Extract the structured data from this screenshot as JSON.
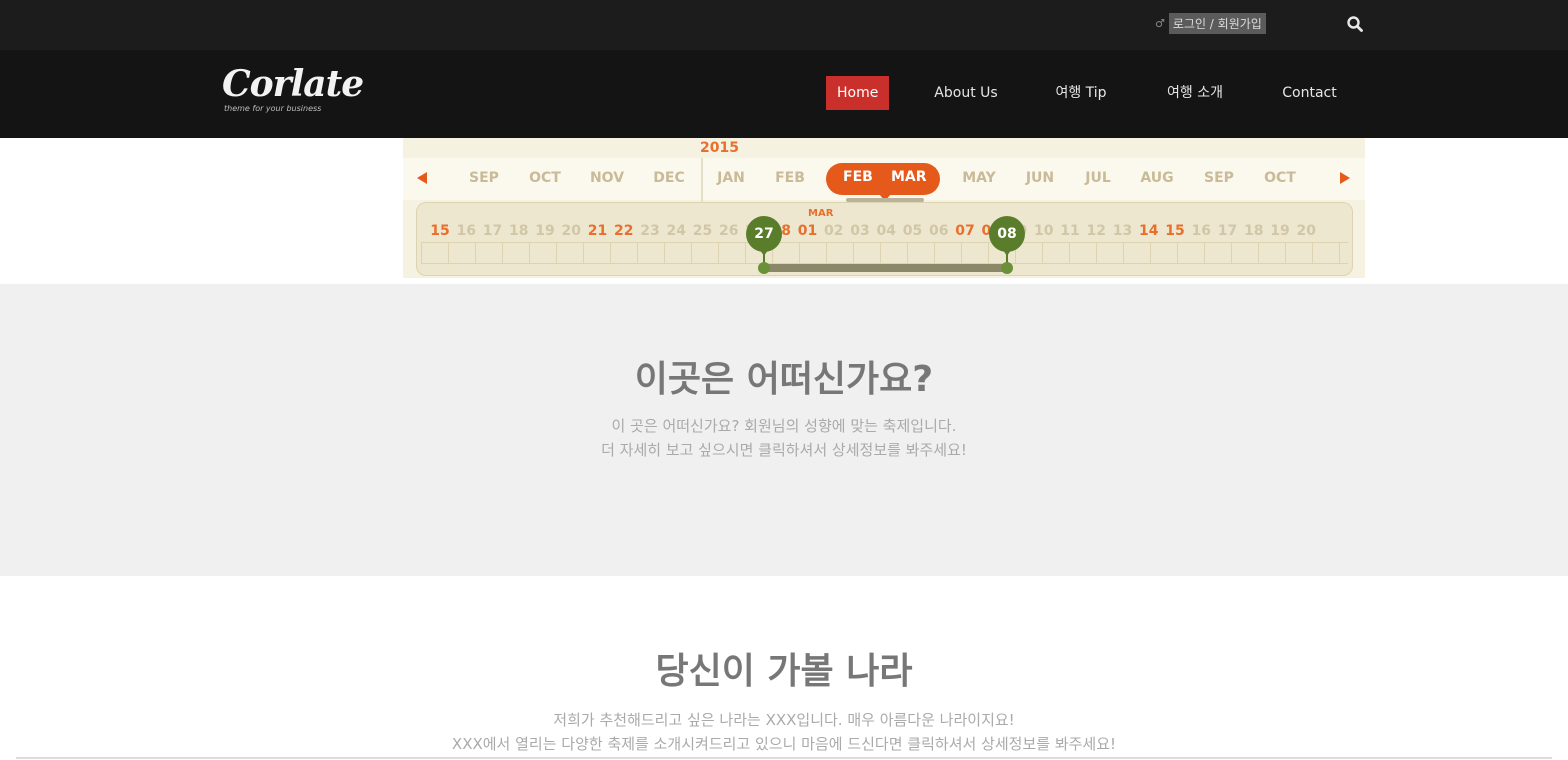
{
  "header": {
    "login_text": "로그인 / 회원가입",
    "person_glyph": "♂"
  },
  "logo": {
    "name": "Corlate",
    "tagline": "theme for your business"
  },
  "nav": {
    "items": [
      {
        "label": "Home",
        "active": true
      },
      {
        "label": "About Us",
        "active": false
      },
      {
        "label": "여행 Tip",
        "active": false
      },
      {
        "label": "여행 소개",
        "active": false
      },
      {
        "label": "Contact",
        "active": false
      }
    ]
  },
  "timeline": {
    "year": "2015",
    "months": [
      "SEP",
      "OCT",
      "NOV",
      "DEC",
      "JAN",
      "FEB",
      "FEB",
      "MAR",
      "MAY",
      "JUN",
      "JUL",
      "AUG",
      "SEP",
      "OCT"
    ],
    "selected_months": [
      "FEB",
      "MAR"
    ],
    "mar_label": "MAR",
    "days": [
      {
        "v": "15",
        "red": true
      },
      {
        "v": "16",
        "red": false
      },
      {
        "v": "17",
        "red": false
      },
      {
        "v": "18",
        "red": false
      },
      {
        "v": "19",
        "red": false
      },
      {
        "v": "20",
        "red": false
      },
      {
        "v": "21",
        "red": true
      },
      {
        "v": "22",
        "red": true
      },
      {
        "v": "23",
        "red": false
      },
      {
        "v": "24",
        "red": false
      },
      {
        "v": "25",
        "red": false
      },
      {
        "v": "26",
        "red": false
      },
      {
        "v": "27",
        "red": false
      },
      {
        "v": "28",
        "red": true
      },
      {
        "v": "01",
        "red": true
      },
      {
        "v": "02",
        "red": false
      },
      {
        "v": "03",
        "red": false
      },
      {
        "v": "04",
        "red": false
      },
      {
        "v": "05",
        "red": false
      },
      {
        "v": "06",
        "red": false
      },
      {
        "v": "07",
        "red": true
      },
      {
        "v": "08",
        "red": true
      },
      {
        "v": "09",
        "red": false
      },
      {
        "v": "10",
        "red": false
      },
      {
        "v": "11",
        "red": false
      },
      {
        "v": "12",
        "red": false
      },
      {
        "v": "13",
        "red": false
      },
      {
        "v": "14",
        "red": true
      },
      {
        "v": "15",
        "red": true
      },
      {
        "v": "16",
        "red": false
      },
      {
        "v": "17",
        "red": false
      },
      {
        "v": "18",
        "red": false
      },
      {
        "v": "19",
        "red": false
      },
      {
        "v": "20",
        "red": false
      }
    ],
    "range_start": "27",
    "range_end": "08"
  },
  "info": {
    "title": "이곳은 어떠신가요?",
    "line1": "이 곳은 어떠신가요? 회원님의 성향에 맞는 축제입니다.",
    "line2": "더 자세히 보고 싶으시면 클릭하셔서 상세정보를 봐주세요!"
  },
  "countries": {
    "title": "당신이 가볼 나라",
    "line1": "저희가 추천해드리고 싶은 나라는 XXX입니다. 매우 아름다운 나라이지요!",
    "line2": "XXX에서 열리는 다양한 축제를 소개시켜드리고 있으니 마음에 드신다면 클릭하셔서 상세정보를 봐주세요!"
  },
  "colors": {
    "accent": "#e55a1b",
    "nav_active": "#c9302c",
    "handle": "#5a7d2c"
  },
  "icons": {
    "search": "search-icon",
    "prev": "arrow-left-icon",
    "next": "arrow-right-icon"
  }
}
